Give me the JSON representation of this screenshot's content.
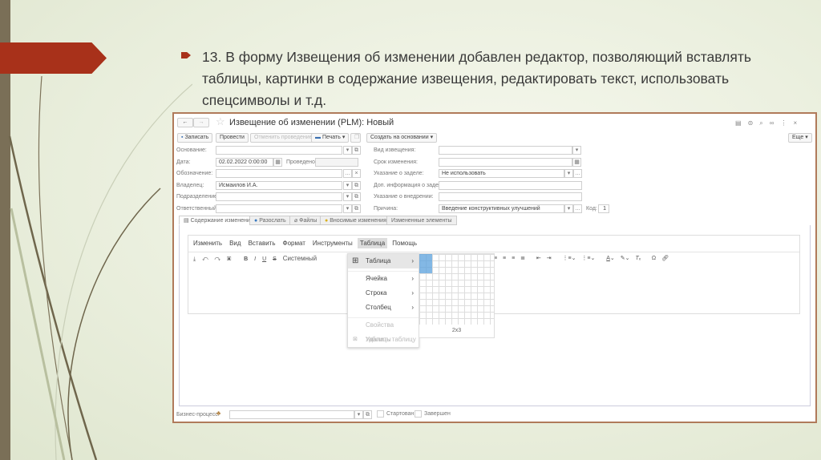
{
  "slide": {
    "heading": "13. В форму Извещения об изменении добавлен редактор, позволяющий вставлять таблицы, картинки в содержание извещения, редактировать текст, использовать спецсимволы и т.д."
  },
  "window": {
    "title": "Извещение об изменении (PLM): Новый"
  },
  "toolbar": {
    "save": "Записать",
    "post": "Провести",
    "unpost": "Отменить проведение",
    "print": "Печать",
    "create_based": "Создать на основании",
    "more": "Еще"
  },
  "form": {
    "left": [
      {
        "label": "Основание:",
        "value": ""
      },
      {
        "label": "Дата:",
        "value": "02.02.2022  0:00:00"
      },
      {
        "label": "Обозначение:",
        "value": ""
      },
      {
        "label": "Владелец:",
        "value": "Исмаилов И.А."
      },
      {
        "label": "Подразделение:",
        "value": ""
      },
      {
        "label": "Ответственный:",
        "value": ""
      }
    ],
    "posted_label": "Проведено",
    "right": [
      {
        "label": "Вид извещения:",
        "value": ""
      },
      {
        "label": "Срок изменения:",
        "value": ""
      },
      {
        "label": "Указание о заделе:",
        "value": "Не использовать"
      },
      {
        "label": "Доп. информация о задела:",
        "value": ""
      },
      {
        "label": "Указание о внедрении:",
        "value": ""
      },
      {
        "label": "Причина:",
        "value": "Введение конструктивных улучшений"
      }
    ],
    "code_label": "Код:",
    "code_value": "1"
  },
  "tabs": [
    "Содержание изменений",
    "Разослать",
    "Файлы",
    "Вносимые изменения",
    "Измененные элементы"
  ],
  "editor": {
    "menu": [
      "Изменить",
      "Вид",
      "Вставить",
      "Формат",
      "Инструменты",
      "Таблица",
      "Помощь"
    ],
    "font": "Системный"
  },
  "table_menu": {
    "items": [
      "Таблица",
      "Ячейка",
      "Строка",
      "Столбец"
    ],
    "disabled": [
      "Свойства таблицы",
      "Удалить таблицу"
    ],
    "grid_size": "2x3"
  },
  "footer": {
    "label": "Бизнес-процесс:",
    "started": "Стартован",
    "finished": "Завершен"
  }
}
